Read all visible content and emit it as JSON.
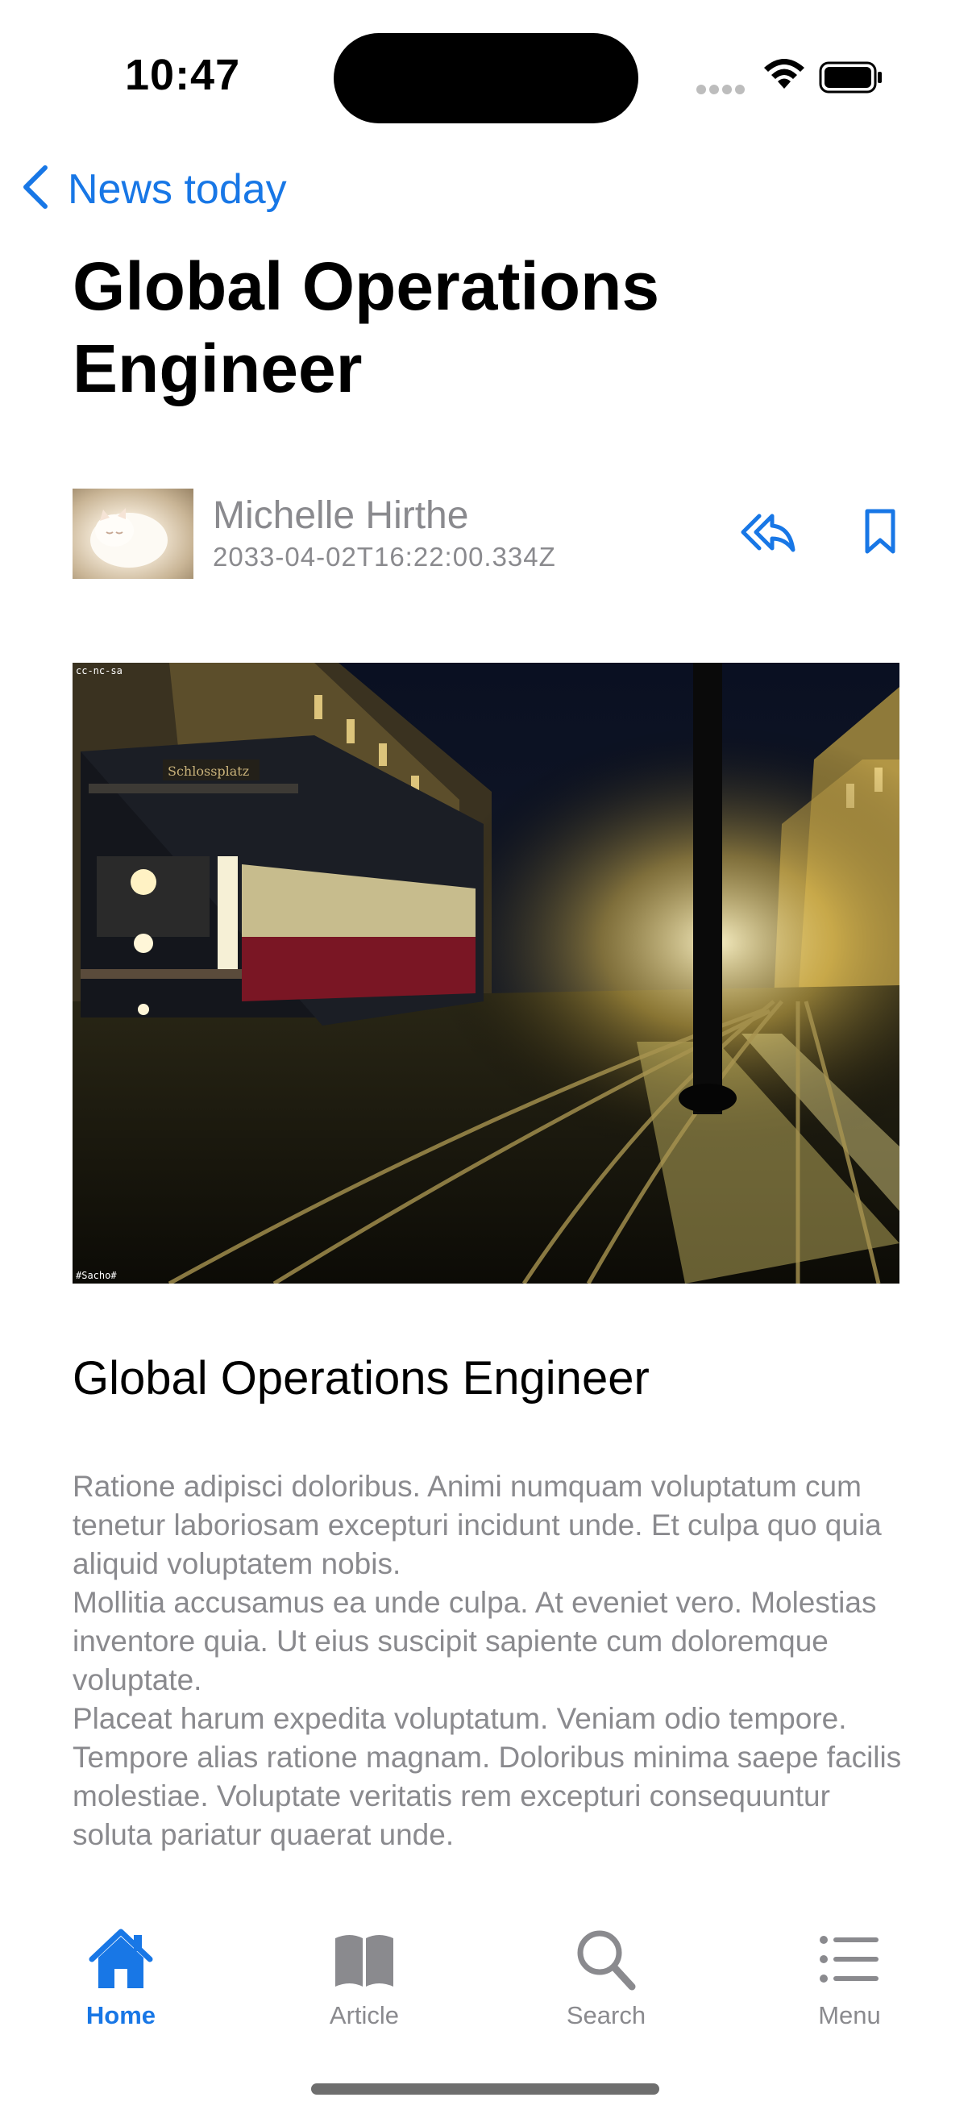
{
  "status_bar": {
    "time": "10:47"
  },
  "nav": {
    "back_label": "News today"
  },
  "article": {
    "title": "Global Operations Engineer",
    "author": "Michelle Hirthe",
    "date": "2033-04-02T16:22:00.334Z",
    "image_watermark_top": "cc-nc-sa",
    "image_watermark_bottom": "#Sacho#",
    "image_sign": "Schlossplatz",
    "heading": "Global Operations Engineer",
    "paragraphs": [
      "Ratione adipisci doloribus. Animi numquam voluptatum cum tenetur laboriosam excepturi incidunt unde. Et culpa quo quia aliquid voluptatem nobis.",
      "Mollitia accusamus ea unde culpa. At eveniet vero. Molestias inventore quia. Ut eius suscipit sapiente cum doloremque voluptate.",
      "Placeat harum expedita voluptatum. Veniam odio tempore. Tempore alias ratione magnam. Doloribus minima saepe facilis molestiae. Voluptate veritatis rem excepturi consequuntur soluta pariatur quaerat unde."
    ]
  },
  "tabs": [
    {
      "label": "Home",
      "icon": "house-icon",
      "active": true
    },
    {
      "label": "Article",
      "icon": "book-icon",
      "active": false
    },
    {
      "label": "Search",
      "icon": "magnifier-icon",
      "active": false
    },
    {
      "label": "Menu",
      "icon": "list-icon",
      "active": false
    }
  ],
  "colors": {
    "accent": "#1877e6",
    "secondary_text": "#8a8a8e",
    "inactive_tab": "#8a8a8e"
  }
}
